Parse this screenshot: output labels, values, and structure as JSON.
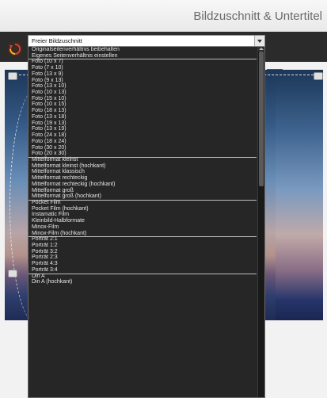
{
  "window": {
    "title": "Bildzuschnitt & Untertitel"
  },
  "combo": {
    "value": "Freier Bildzuschnitt"
  },
  "dropdown": {
    "groups": [
      [
        "Originalseitenverhältnis beibehalten",
        "Eigenes Seitenverhältnis einstellen"
      ],
      [
        "Foto (10 x 7)",
        "Foto (7 x 10)",
        "Foto (13 x 9)",
        "Foto (9 x 13)",
        "Foto (13 x 10)",
        "Foto (10 x 13)",
        "Foto (15 x 10)",
        "Foto (10 x 15)",
        "Foto (18 x 13)",
        "Foto (13 x 18)",
        "Foto (19 x 13)",
        "Foto (13 x 19)",
        "Foto (24 x 18)",
        "Foto (18 x 24)",
        "Foto (30 x 20)",
        "Foto (20 x 30)"
      ],
      [
        "Mittelformat kleinst",
        "Mittelformat kleinst (hochkant)",
        "Mittelformat klassisch",
        "Mittelformat rechteckig",
        "Mittelformat rechteckig (hochkant)",
        "Mittelformat groß",
        "Mittelformat groß (hochkant)"
      ],
      [
        "Pocket Film",
        "Pocket Film (hochkant)",
        "Instamatic Film",
        "Kleinbild-Halbformate",
        "Minox-Film",
        "Minox-Film (hochkant)"
      ],
      [
        "Porträt 2:1",
        "Porträt 1:2",
        "Porträt 3:2",
        "Porträt 2:3",
        "Porträt 4:3",
        "Porträt 3:4"
      ],
      [
        "Din A",
        "Din A (hochkant)"
      ]
    ]
  }
}
